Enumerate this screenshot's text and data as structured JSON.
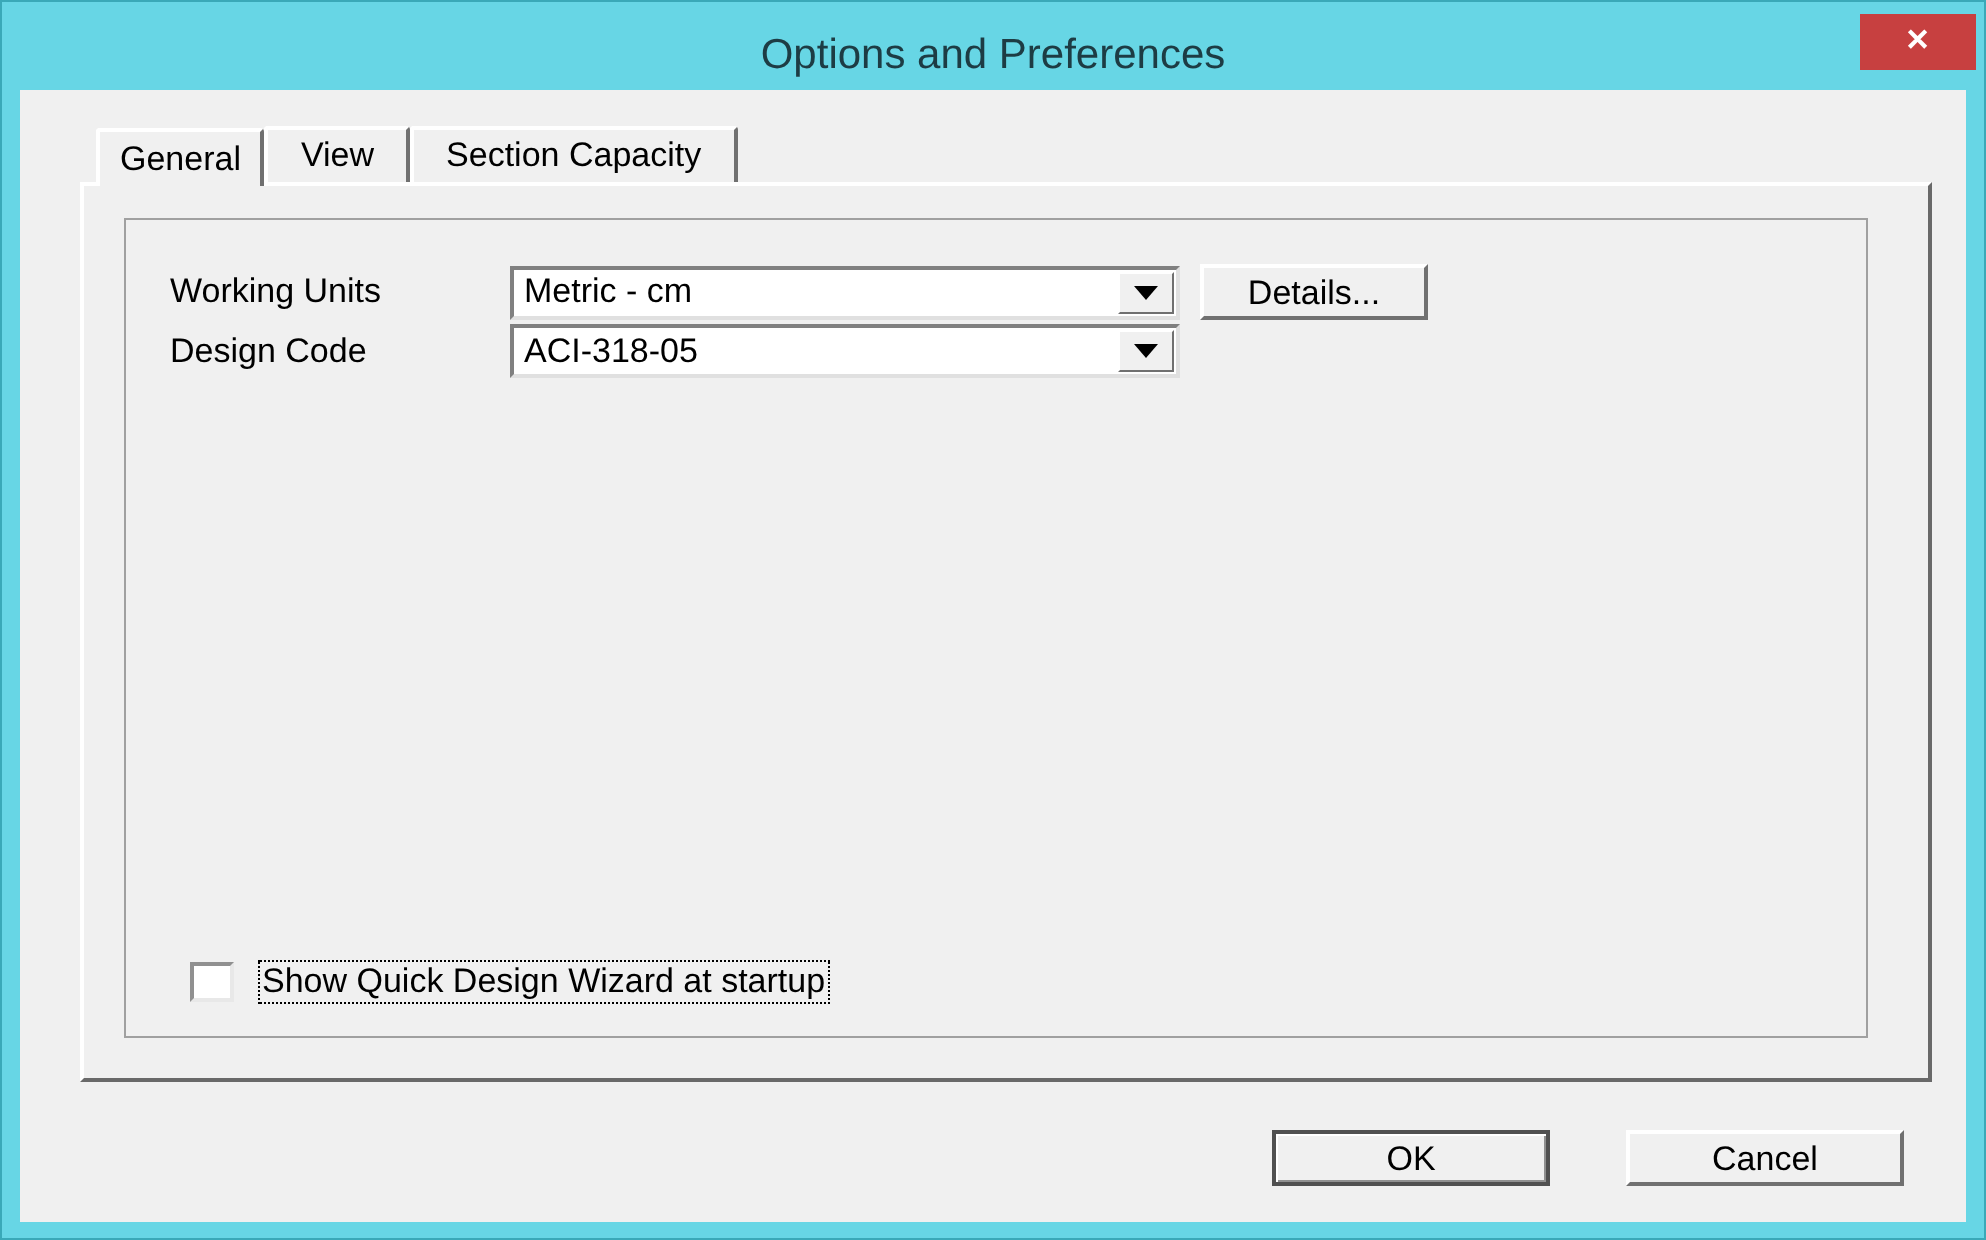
{
  "window": {
    "title": "Options and Preferences",
    "close": "✕"
  },
  "tabs": [
    {
      "label": "General",
      "selected": true
    },
    {
      "label": "View",
      "selected": false
    },
    {
      "label": "Section Capacity",
      "selected": false
    }
  ],
  "fields": [
    {
      "label": "Working Units",
      "value": "Metric - cm",
      "button": "Details..."
    },
    {
      "label": "Design Code",
      "value": "ACI-318-05"
    }
  ],
  "startup_wizard": {
    "label": "Show Quick Design Wizard at startup",
    "checked": false
  },
  "buttons": [
    {
      "label": "OK",
      "default": true
    },
    {
      "label": "Cancel",
      "default": false
    }
  ]
}
